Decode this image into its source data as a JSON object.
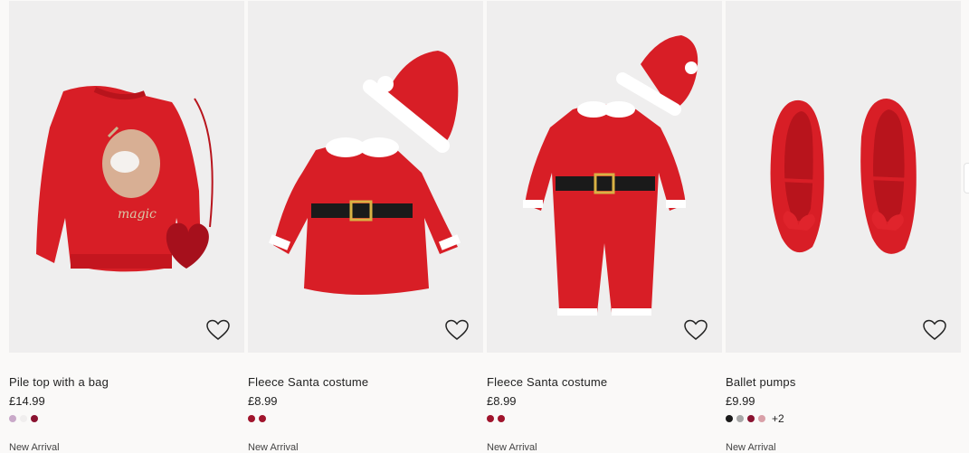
{
  "products": [
    {
      "name": "Pile top with a bag",
      "price": "£14.99",
      "swatches": [
        "#c9a9c9",
        "#f0eeee",
        "#8a1230"
      ],
      "more": "",
      "badge": "New Arrival",
      "image_icon": "sweater-with-bag-image"
    },
    {
      "name": "Fleece Santa costume",
      "price": "£8.99",
      "swatches": [
        "#a0142c",
        "#a0142c"
      ],
      "more": "",
      "badge": "New Arrival",
      "image_icon": "santa-dress-image"
    },
    {
      "name": "Fleece Santa costume",
      "price": "£8.99",
      "swatches": [
        "#a0142c",
        "#a0142c"
      ],
      "more": "",
      "badge": "New Arrival",
      "image_icon": "santa-romper-image"
    },
    {
      "name": "Ballet pumps",
      "price": "£9.99",
      "swatches": [
        "#1a1a1a",
        "#a8a8a8",
        "#8a1230",
        "#d9a0a8"
      ],
      "more": "+2",
      "badge": "New Arrival",
      "image_icon": "ballet-pumps-image"
    }
  ],
  "colors": {
    "background": "#faf9f8",
    "image_background": "#efeeee",
    "product_red": "#d81e26"
  }
}
